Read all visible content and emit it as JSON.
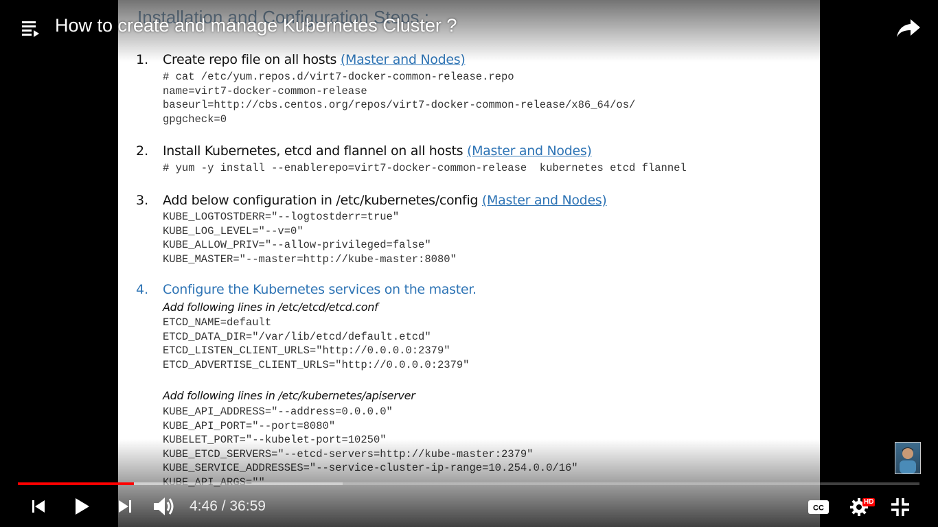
{
  "header": {
    "title": "How to create and manage Kubernetes Cluster ?"
  },
  "slide": {
    "title": "Installation and Configuration Steps :",
    "steps": [
      {
        "num": "1.",
        "text": "Create repo file on all hosts ",
        "link": "(Master and Nodes)",
        "code": [
          "# cat /etc/yum.repos.d/virt7-docker-common-release.repo",
          "name=virt7-docker-common-release",
          "baseurl=http://cbs.centos.org/repos/virt7-docker-common-release/x86_64/os/",
          "gpgcheck=0"
        ]
      },
      {
        "num": "2.",
        "text": "Install Kubernetes, etcd and flannel on all hosts ",
        "link": "(Master and Nodes)",
        "code": [
          "# yum -y install --enablerepo=virt7-docker-common-release  kubernetes etcd flannel"
        ]
      },
      {
        "num": "3.",
        "text": "Add below configuration in /etc/kubernetes/config  ",
        "link": "(Master and Nodes)",
        "code": [
          "KUBE_LOGTOSTDERR=\"--logtostderr=true\"",
          "KUBE_LOG_LEVEL=\"--v=0\"",
          "KUBE_ALLOW_PRIV=\"--allow-privileged=false\"",
          "KUBE_MASTER=\"--master=http://kube-master:8080\""
        ]
      },
      {
        "num": "4.",
        "text": "Configure the Kubernetes services on the master.",
        "sub1": "Add following lines in /etc/etcd/etcd.conf",
        "code1": [
          "ETCD_NAME=default",
          "ETCD_DATA_DIR=\"/var/lib/etcd/default.etcd\"",
          "ETCD_LISTEN_CLIENT_URLS=\"http://0.0.0.0:2379\"",
          "ETCD_ADVERTISE_CLIENT_URLS=\"http://0.0.0.0:2379\""
        ],
        "sub2": "Add following lines in /etc/kubernetes/apiserver",
        "code2": [
          "KUBE_API_ADDRESS=\"--address=0.0.0.0\"",
          "KUBE_API_PORT=\"--port=8080\"",
          "KUBELET_PORT=\"--kubelet-port=10250\"",
          "KUBE_ETCD_SERVERS=\"--etcd-servers=http://kube-master:2379\"",
          "KUBE_SERVICE_ADDRESSES=\"--service-cluster-ip-range=10.254.0.0/16\"",
          "KUBE_API_ARGS=\"\""
        ]
      }
    ]
  },
  "controls": {
    "time": "4:46 / 36:59",
    "progress_played": 0.129,
    "progress_loaded": 0.36,
    "hd_badge": "HD"
  },
  "icons": {
    "playlist": "playlist-icon",
    "share": "share-icon",
    "prev": "skip-previous-icon",
    "play": "play-icon",
    "next": "skip-next-icon",
    "volume": "volume-icon",
    "cc": "closed-captions-icon",
    "settings": "gear-icon",
    "exit_fullscreen": "exit-fullscreen-icon"
  }
}
